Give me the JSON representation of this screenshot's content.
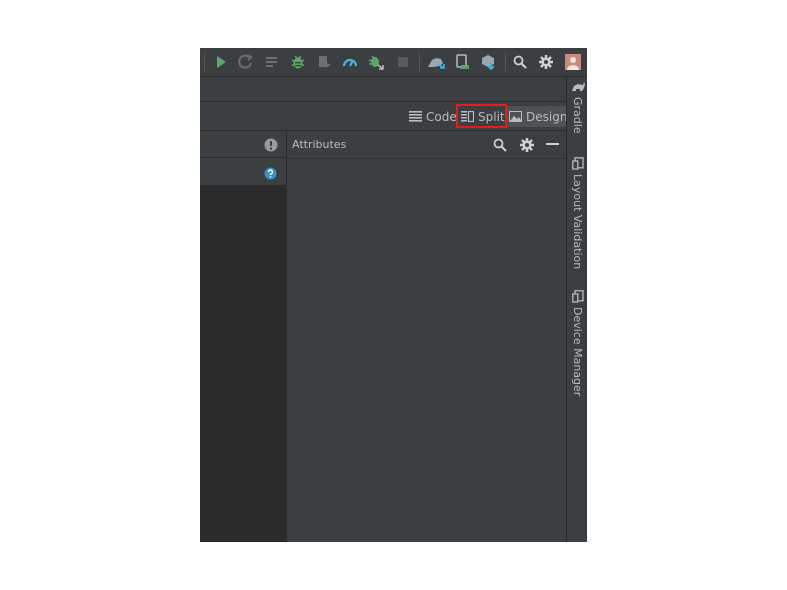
{
  "toolbar": {
    "icons": [
      "run-icon",
      "apply-changes-icon",
      "apply-code-changes-icon",
      "debug-icon",
      "attach-debugger-icon",
      "profile-icon",
      "debug-bug-icon",
      "stop-icon",
      "sync-icon",
      "device-manager-icon",
      "sdk-manager-icon",
      "search-icon",
      "settings-icon",
      "account-icon"
    ]
  },
  "modes": {
    "code": "Code",
    "split": "Split",
    "design": "Design",
    "selected": "Split"
  },
  "attributes_panel": {
    "title": "Attributes"
  },
  "sidebar": {
    "tabs": [
      {
        "label": "Gradle",
        "icon": "elephant-icon"
      },
      {
        "label": "Layout Validation",
        "icon": "layout-validation-icon"
      },
      {
        "label": "Device Manager",
        "icon": "device-icon"
      }
    ]
  },
  "colors": {
    "bg": "#3c3f41",
    "dark": "#2b2b2b",
    "text": "#bbbbbb",
    "green": "#59a869",
    "blue": "#40b6e0",
    "highlight": "#e11d1d"
  }
}
